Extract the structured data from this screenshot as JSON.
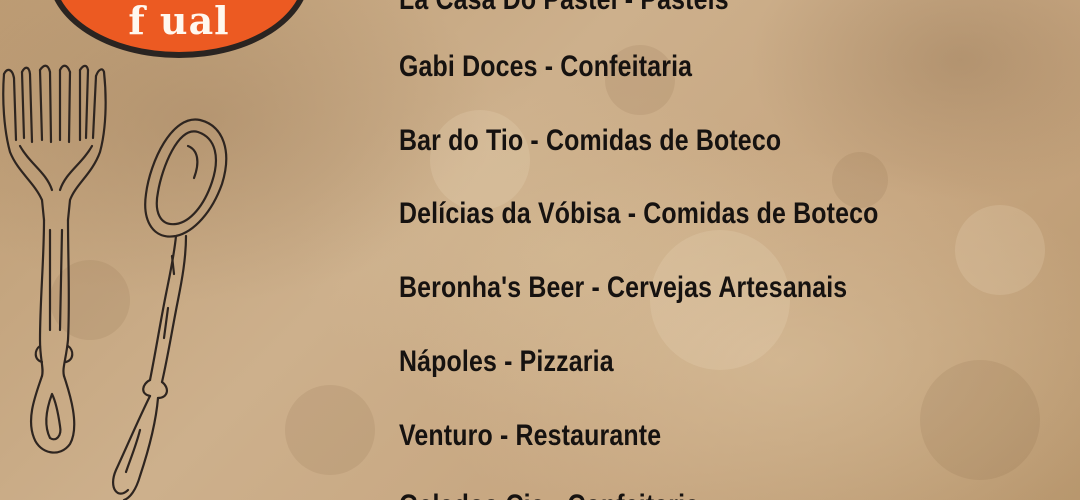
{
  "logo": {
    "visible_text": "f   ual"
  },
  "colors": {
    "background": "#c9ab86",
    "logo_fill": "#ec5a22",
    "logo_ring": "#2a2421",
    "text": "#161210"
  },
  "decorations": {
    "fork": "fork-icon",
    "spoon": "spoon-icon"
  },
  "menu": {
    "items": [
      {
        "label": "La Casa Do Pastel - Pastéis"
      },
      {
        "label": "Gabi Doces - Confeitaria"
      },
      {
        "label": "Bar do Tio - Comidas de Boteco"
      },
      {
        "label": "Delícias da Vóbisa - Comidas de Boteco"
      },
      {
        "label": "Beronha's Beer - Cervejas Artesanais"
      },
      {
        "label": "Nápoles - Pizzaria"
      },
      {
        "label": "Venturo - Restaurante"
      },
      {
        "label": "Gelados Cia - Confeitaria"
      }
    ]
  }
}
